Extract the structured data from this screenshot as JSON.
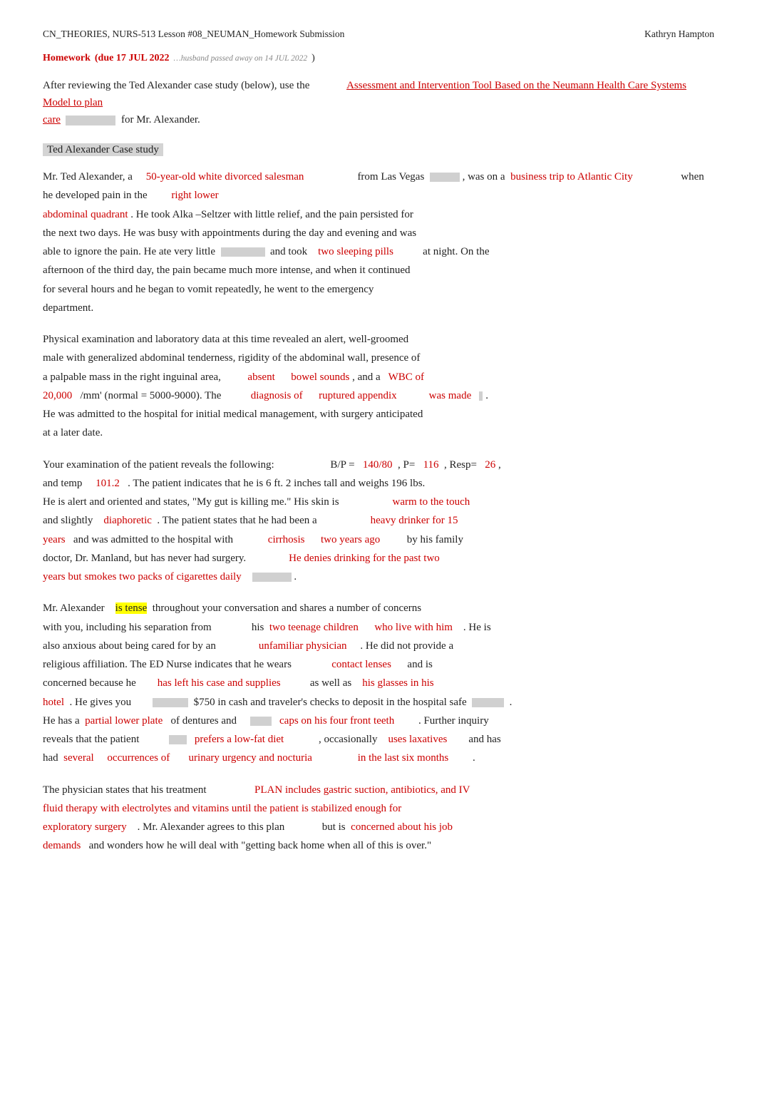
{
  "header": {
    "left": "CN_THEORIES, NURS-513 Lesson #08_NEUMAN_Homework Submission",
    "right": "Kathryn Hampton"
  },
  "homework": {
    "label": "Homework",
    "due": "(due 17 JUL 2022",
    "note": "…husband passed away on 14 JUL 2022",
    "close": ")"
  },
  "intro": {
    "text1": "After reviewing the Ted Alexander case study (below), use the",
    "highlight1": "Assessment and Intervention Tool Based on the Neumann Health Care Systems Model to plan",
    "highlight2": "care",
    "text2": "for Mr. Alexander."
  },
  "case_title": "Ted Alexander Case study",
  "para1": {
    "full": "Mr. Ted Alexander, a [50-year-old white divorced salesman] from Las Vegas [gray-box], was on a [business trip to Atlantic City] [gray-box2] when he developed pain in the [right lower abdominal quadrant] . He took Alka –Seltzer with little relief, and the pain persisted for the next two days. He was busy with appointments during the day and evening and was able to ignore the pain. He ate very little [gray-box3] and took [two sleeping pills] [gray-box4] at night. On the afternoon of the third day, the pain became much more intense, and when it continued for several hours and he began to vomit repeatedly, he went to the emergency department."
  },
  "para2": {
    "full": "Physical examination and laboratory data at this time revealed an alert, well-groomed male with generalized abdominal tenderness, rigidity of the abdominal wall, presence of a palpable mass in the right inguinal area, [absent] [bowel sounds] , and a [WBC of 20,000] /mm' (normal = 5000-9000). The [gray1] [diagnosis of] [ruptured appendix] [was made] . He was admitted to the hospital for initial medical management, with surgery anticipated at a later date."
  },
  "para3": {
    "full": "Your examination of the patient reveals the following: [gray2] B/P = [140/80] , P= [116] , Resp= [26] , and temp [101.2] . The patient indicates that he is 6 ft. 2 inches tall and weighs 196 lbs. He is alert and oriented and states, \"My gut is killing me.\" His skin is [warm to the touch] and slightly [diaphoretic] . The patient states that he had been a [heavy drinker for 15 years] and was admitted to the hospital with [cirrhosis] [two years ago] [gray3] by his family doctor, Dr. Manland, but has never had surgery. [He denies drinking for the past two years but smokes two packs of cigarettes daily] [gray4] ."
  },
  "para4": {
    "full": "Mr. Alexander [is tense] throughout your conversation and shares a number of concerns with you, including his separation from [gray5] his [two teenage children] [who live with him] . He is also anxious about being cared for by an [unfamiliar physician] . He did not provide a religious affiliation. The ED Nurse indicates that he wears [gray6] [contact lenses] [gray7] and is concerned because he [has left his case and supplies] [gray8] as well as [his glasses in his hotel] . He gives you [gray9] $750 in cash and traveler's checks to deposit in the hospital safe [gray10] . He has a [partial lower plate] of dentures and [gray11] [caps on his four front teeth] [gray12] . Further inquiry reveals that the patient [gray13] [prefers a low-fat diet] [gray14] , occasionally [uses laxatives] [gray15] and has had [several] [occurrences of] [urinary urgency and nocturia] [gray16] [in the last six months] [gray17] ."
  },
  "para5": {
    "full": "The physician states that his treatment [gray18] [PLAN includes gastric suction, antibiotics, and IV fluid therapy with electrolytes and vitamins until the patient is stabilized enough for exploratory surgery] . Mr. Alexander agrees to this plan [gray19] but is [concerned about his job demands] and wonders how he will deal with \"getting back home when all of this is over.\""
  },
  "colors": {
    "red": "#cc0000",
    "green": "#1a6b1a",
    "teal": "#007070",
    "yellow_bg": "#ffff00",
    "gray_bg": "#c8c8c8"
  }
}
